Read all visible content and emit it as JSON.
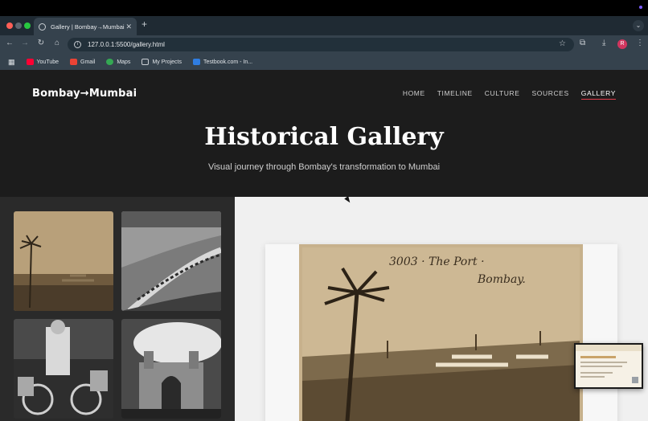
{
  "browser": {
    "tab_title": "Gallery | Bombay→Mumbai",
    "new_tab": "+",
    "address": "127.0.0.1:5500/gallery.html",
    "bookmarks": [
      {
        "label": "YouTube",
        "icon": "youtube-icon",
        "color": "#ff0033"
      },
      {
        "label": "Gmail",
        "icon": "gmail-icon",
        "color": "#ea4335"
      },
      {
        "label": "Maps",
        "icon": "maps-icon",
        "color": "#34a853"
      },
      {
        "label": "My Projects",
        "icon": "folder-icon",
        "color": "#c9ced3"
      },
      {
        "label": "Testbook.com - In...",
        "icon": "testbook-icon",
        "color": "#2f7de1"
      }
    ],
    "avatar_letter": "R"
  },
  "site": {
    "logo": "Bombay→Mumbai",
    "nav": [
      {
        "label": "HOME",
        "active": false
      },
      {
        "label": "TIMELINE",
        "active": false
      },
      {
        "label": "CULTURE",
        "active": false
      },
      {
        "label": "SOURCES",
        "active": false
      },
      {
        "label": "GALLERY",
        "active": true
      }
    ],
    "hero_title": "Historical Gallery",
    "hero_subtitle": "Visual journey through Bombay's transformation to Mumbai",
    "accent_color": "#e03c4b"
  },
  "gallery": {
    "thumbnails": [
      "port-bombay-photo",
      "marine-drive-photo",
      "dabbawala-photo",
      "gateway-of-india-photo"
    ],
    "featured": {
      "caption_line1": "3003 · The Port ·",
      "caption_line2": "Bombay."
    }
  }
}
